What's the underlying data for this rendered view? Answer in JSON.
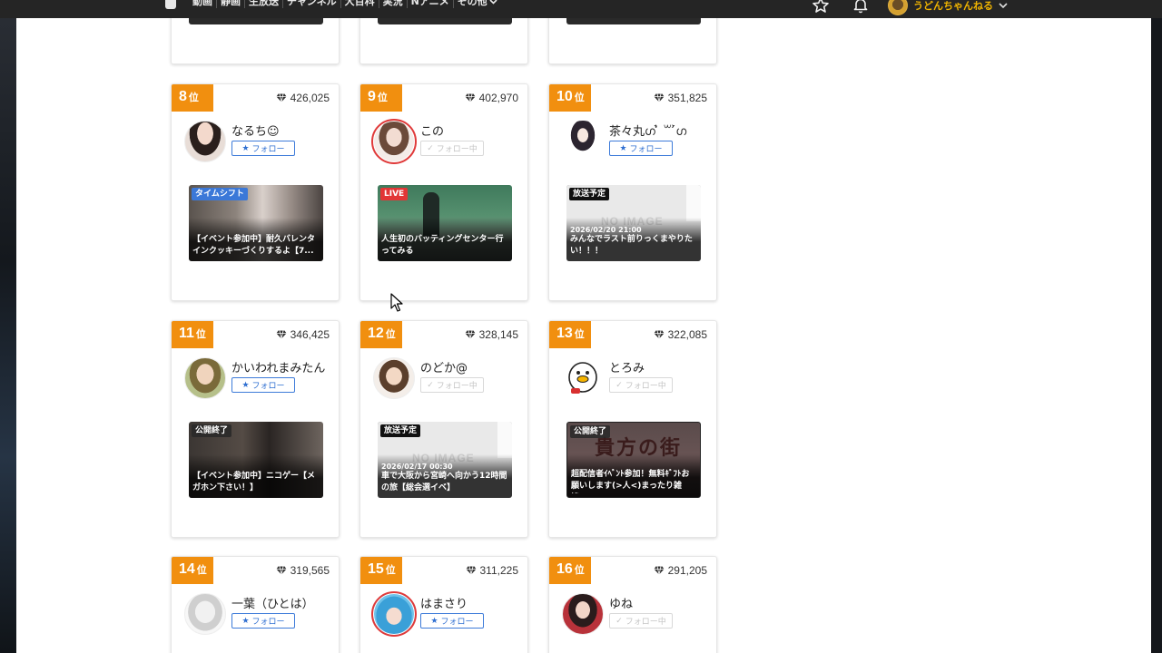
{
  "nav": {
    "items": [
      "動画",
      "静画",
      "生放送",
      "チャンネル",
      "大百科",
      "実況",
      "Nアニメ",
      "その他"
    ],
    "username": "うどんちゃんねる"
  },
  "accent_color": "#f18f0f",
  "follow_label": "フォロー",
  "following_label": "フォロー中",
  "rank_suffix": "位",
  "cards": [
    {
      "rank": "8",
      "points": "426,025",
      "name": "なるち☺",
      "following": false,
      "avatar_live": false,
      "badge": "タイムシフト",
      "badge_type": "timeshift",
      "date": "",
      "title": "【イベント参加中】耐久バレンタインクッキーづくりするよ【7...",
      "noimage": false
    },
    {
      "rank": "9",
      "points": "402,970",
      "name": "この",
      "following": true,
      "avatar_live": true,
      "badge": "LIVE",
      "badge_type": "live",
      "date": "",
      "title": "人生初のバッティングセンター行ってみる",
      "noimage": false
    },
    {
      "rank": "10",
      "points": "351,825",
      "name": "茶々丸ഗ ͗̀ ꒳ ͗́ഗ",
      "following": false,
      "avatar_live": false,
      "badge": "放送予定",
      "badge_type": "scheduled",
      "date": "2026/02/20 21:00",
      "title": "みんなでラスト前りっくまやりたい！！！",
      "noimage": true
    },
    {
      "rank": "11",
      "points": "346,425",
      "name": "かいわれまみたん",
      "following": false,
      "avatar_live": false,
      "badge": "公開終了",
      "badge_type": "ended",
      "date": "",
      "title": "【イベント参加中】ニコゲー【メガホン下さい！】",
      "noimage": false
    },
    {
      "rank": "12",
      "points": "328,145",
      "name": "のどか@",
      "following": true,
      "avatar_live": false,
      "badge": "放送予定",
      "badge_type": "scheduled",
      "date": "2026/02/17 00:30",
      "title": "車で大阪から宮崎へ向かう12時間の旅【総会選イベ】",
      "noimage": true
    },
    {
      "rank": "13",
      "points": "322,085",
      "name": "とろみ",
      "following": true,
      "avatar_live": false,
      "badge": "公開終了",
      "badge_type": "ended",
      "date": "",
      "title": "超配信者ｲﾍﾞﾝﾄ参加！無料ｷﾞﾌﾄお願いします(>人<)まったり雑談...",
      "noimage": false
    },
    {
      "rank": "14",
      "points": "319,565",
      "name": "一葉（ひとは）",
      "following": false,
      "avatar_live": false,
      "badge": "",
      "badge_type": "",
      "date": "",
      "title": "",
      "noimage": false
    },
    {
      "rank": "15",
      "points": "311,225",
      "name": "はまさり",
      "following": false,
      "avatar_live": true,
      "badge": "",
      "badge_type": "",
      "date": "",
      "title": "",
      "noimage": false
    },
    {
      "rank": "16",
      "points": "291,205",
      "name": "ゆね",
      "following": true,
      "avatar_live": false,
      "badge": "",
      "badge_type": "",
      "date": "",
      "title": "",
      "noimage": false
    }
  ]
}
